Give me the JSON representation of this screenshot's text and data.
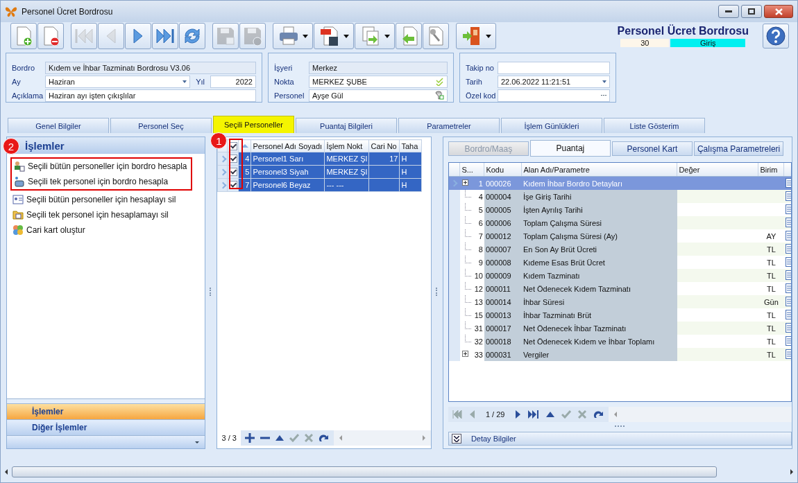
{
  "window": {
    "title": "Personel Ücret Bordrosu"
  },
  "toolbar": [
    [
      {
        "kind": "new",
        "disabled": false,
        "dropdown": false
      },
      {
        "kind": "delete",
        "disabled": false,
        "dropdown": false
      }
    ],
    [
      {
        "kind": "first",
        "disabled": true,
        "dropdown": false
      },
      {
        "kind": "prev",
        "disabled": true,
        "dropdown": false
      },
      {
        "kind": "next",
        "disabled": false,
        "dropdown": false
      },
      {
        "kind": "last",
        "disabled": false,
        "dropdown": false
      },
      {
        "kind": "refresh",
        "disabled": false,
        "dropdown": false
      }
    ],
    [
      {
        "kind": "save",
        "disabled": true,
        "dropdown": false
      },
      {
        "kind": "discard",
        "disabled": true,
        "dropdown": false
      }
    ],
    [
      {
        "kind": "print",
        "disabled": false,
        "dropdown": true
      },
      {
        "kind": "pdf",
        "disabled": false,
        "dropdown": true
      },
      {
        "kind": "export",
        "disabled": false,
        "dropdown": true
      },
      {
        "kind": "import",
        "disabled": false,
        "dropdown": false
      },
      {
        "kind": "tools",
        "disabled": false,
        "dropdown": false
      }
    ],
    [
      {
        "kind": "exit",
        "disabled": false,
        "dropdown": true
      }
    ]
  ],
  "header": {
    "title": "Personel Ücret Bordrosu",
    "count": "30",
    "mode": "Giriş"
  },
  "form_groups": [
    {
      "rows": [
        {
          "fields": [
            {
              "label": "Bordro",
              "value": "Kıdem ve İhbar Tazminatı Bordrosu V3.06",
              "kind": "text",
              "readonly": true
            }
          ]
        },
        {
          "fields": [
            {
              "label": "Ay",
              "value": "Haziran",
              "kind": "dropdown",
              "readonly": false
            },
            {
              "label": "Yıl",
              "value": "2022",
              "kind": "number",
              "readonly": false
            }
          ]
        },
        {
          "fields": [
            {
              "label": "Açıklama",
              "value": "Haziran ayı işten çıkışlılar",
              "kind": "text",
              "readonly": false
            }
          ]
        }
      ]
    },
    {
      "rows": [
        {
          "fields": [
            {
              "label": "İşyeri",
              "value": "Merkez",
              "kind": "text",
              "readonly": true
            }
          ]
        },
        {
          "fields": [
            {
              "label": "Nokta",
              "value": "MERKEZ ŞUBE",
              "kind": "check",
              "readonly": false
            }
          ]
        },
        {
          "fields": [
            {
              "label": "Personel",
              "value": "Ayşe Gül",
              "kind": "lookup",
              "readonly": false
            }
          ]
        }
      ]
    },
    {
      "rows": [
        {
          "fields": [
            {
              "label": "Takip no",
              "kind": "text",
              "readonly": false
            }
          ]
        },
        {
          "fields": [
            {
              "label": "Tarih",
              "value": "22.06.2022 11:21:51",
              "kind": "dropdown",
              "readonly": false
            }
          ]
        },
        {
          "fields": [
            {
              "label": "Özel kod",
              "kind": "ellipsis",
              "readonly": false
            }
          ]
        }
      ]
    }
  ],
  "tabs": [
    {
      "label": "Genel Bilgiler",
      "selected": false
    },
    {
      "label": "Personel Seç",
      "selected": false
    },
    {
      "label": "Seçili Personeller",
      "selected": true
    },
    {
      "label": "Puantaj Bilgileri",
      "selected": false
    },
    {
      "label": "Parametreler",
      "selected": false
    },
    {
      "label": "İşlem Günlükleri",
      "selected": false
    },
    {
      "label": "Liste Gösterim",
      "selected": false
    }
  ],
  "left_panel": {
    "badge": "2",
    "title": "İşlemler",
    "action_groups": [
      {
        "highlighted": true,
        "items": [
          {
            "kind": "people",
            "label": "Seçili bütün personeller için bordro hesapla"
          },
          {
            "kind": "person",
            "label": "Seçili tek personel için bordro hesapla"
          }
        ]
      },
      {
        "highlighted": false,
        "items": [
          {
            "kind": "card",
            "label": "Seçili bütün personeller için hesaplayı sil"
          },
          {
            "kind": "folder",
            "label": "Seçili tek personel için hesaplamayı sil"
          },
          {
            "kind": "coins",
            "label": "Cari kart oluştur"
          }
        ]
      }
    ],
    "sections": [
      {
        "label": "İşlemler",
        "selected": true
      },
      {
        "label": "Diğer İşlemler",
        "selected": false
      }
    ]
  },
  "selected_grid": {
    "badge": "1",
    "header_checked": true,
    "columns": [
      "Personel Adı Soyadı",
      "İşlem Nokt",
      "Cari No",
      "Taha"
    ],
    "rows": [
      {
        "no": "4",
        "name": "Personel1 Sarı",
        "point": "MERKEZ Şl",
        "cari": "17",
        "taha": "H",
        "checked": true,
        "selected": true
      },
      {
        "no": "5",
        "name": "Personel3 Siyah",
        "point": "MERKEZ Şl",
        "cari": "",
        "taha": "H",
        "checked": true,
        "selected": true
      },
      {
        "no": "7",
        "name": "Personel6 Beyaz",
        "point": "--- ---",
        "cari": "",
        "taha": "H",
        "checked": true,
        "selected": true
      }
    ],
    "pager": "3 / 3"
  },
  "detail_tabs": [
    {
      "label": "Bordro/Maaş",
      "selected": false,
      "disabled": true
    },
    {
      "label": "Puantaj",
      "selected": true,
      "disabled": false
    },
    {
      "label": "Personel Kart",
      "selected": false,
      "disabled": false
    },
    {
      "label": "Çalışma Parametreleri",
      "selected": false,
      "disabled": false
    }
  ],
  "parameters": {
    "columns": [
      "S...",
      "Kodu",
      "Alan Adı/Parametre",
      "Değer",
      "Birim"
    ],
    "rows": [
      {
        "no": "1",
        "code": "000026",
        "name": "Kıdem İhbar Bordro Detayları",
        "expandable": true,
        "selected": true,
        "children": [
          {
            "no": "4",
            "code": "000004",
            "name": "İşe Giriş Tarihi",
            "selected": false
          },
          {
            "no": "5",
            "code": "000005",
            "name": "İşten Ayrılış Tarihi",
            "selected": false
          },
          {
            "no": "6",
            "code": "000006",
            "name": "Toplam Çalışma Süresi",
            "selected": false
          },
          {
            "no": "7",
            "code": "000012",
            "name": "Toplam Çalışma Süresi (Ay)",
            "unit": "AY",
            "selected": false
          },
          {
            "no": "8",
            "code": "000007",
            "name": "En Son Ay Brüt Ücreti",
            "unit": "TL",
            "selected": false
          },
          {
            "no": "9",
            "code": "000008",
            "name": "Kıdeme Esas Brüt Ücret",
            "unit": "TL",
            "selected": false
          },
          {
            "no": "10",
            "code": "000009",
            "name": "Kıdem Tazminatı",
            "unit": "TL",
            "selected": false
          },
          {
            "no": "12",
            "code": "000011",
            "name": "Net Ödenecek Kıdem Tazminatı",
            "unit": "TL",
            "selected": false
          },
          {
            "no": "13",
            "code": "000014",
            "name": "İhbar Süresi",
            "unit": "Gün",
            "selected": false
          },
          {
            "no": "15",
            "code": "000013",
            "name": "İhbar Tazminatı Brüt",
            "unit": "TL",
            "selected": false
          },
          {
            "no": "31",
            "code": "000017",
            "name": "Net Ödenecek İhbar Tazminatı",
            "unit": "TL",
            "selected": false
          },
          {
            "no": "32",
            "code": "000018",
            "name": "Net Ödenecek Kıdem ve İhbar Toplamı",
            "unit": "TL",
            "selected": false
          }
        ]
      },
      {
        "no": "33",
        "code": "000031",
        "name": "Vergiler",
        "unit": "TL",
        "expandable": true,
        "selected": false
      }
    ],
    "pager": "1 / 29"
  },
  "detail_bar": {
    "label": "Detay Bilgiler"
  }
}
